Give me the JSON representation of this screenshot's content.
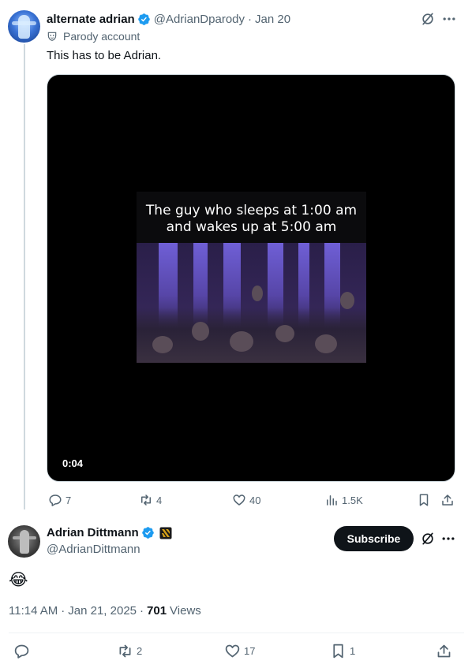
{
  "parent_tweet": {
    "display_name": "alternate adrian",
    "handle": "@AdrianDparody",
    "separator": "·",
    "date": "Jan 20",
    "parody_label": "Parody account",
    "text": "This has to be Adrian.",
    "video": {
      "caption": "The guy who sleeps at 1:00 am\nand wakes up at 5:00 am",
      "duration": "0:04"
    },
    "actions": {
      "replies": "7",
      "reposts": "4",
      "likes": "40",
      "views": "1.5K"
    }
  },
  "main_tweet": {
    "display_name": "Adrian Dittmann",
    "handle": "@AdrianDittmann",
    "subscribe_label": "Subscribe",
    "text": "😂",
    "time": "11:14 AM",
    "date_sep": "·",
    "date": "Jan 21, 2025",
    "views_sep": "·",
    "views_count": "701",
    "views_label": "Views",
    "actions": {
      "replies": "",
      "reposts": "2",
      "likes": "17",
      "bookmarks": "1"
    }
  },
  "colors": {
    "verified": "#1d9bf0",
    "secondary_text": "#536471",
    "primary_text": "#0f1419",
    "subscribe_bg": "#0f1419"
  },
  "icons": {
    "grok": "grok-icon",
    "more": "more-icon",
    "reply": "reply-icon",
    "repost": "repost-icon",
    "like": "heart-icon",
    "views": "views-icon",
    "bookmark": "bookmark-icon",
    "share": "share-icon",
    "parody": "parody-mask-icon",
    "verified": "verified-badge-icon",
    "affiliation": "affiliation-badge-icon"
  }
}
